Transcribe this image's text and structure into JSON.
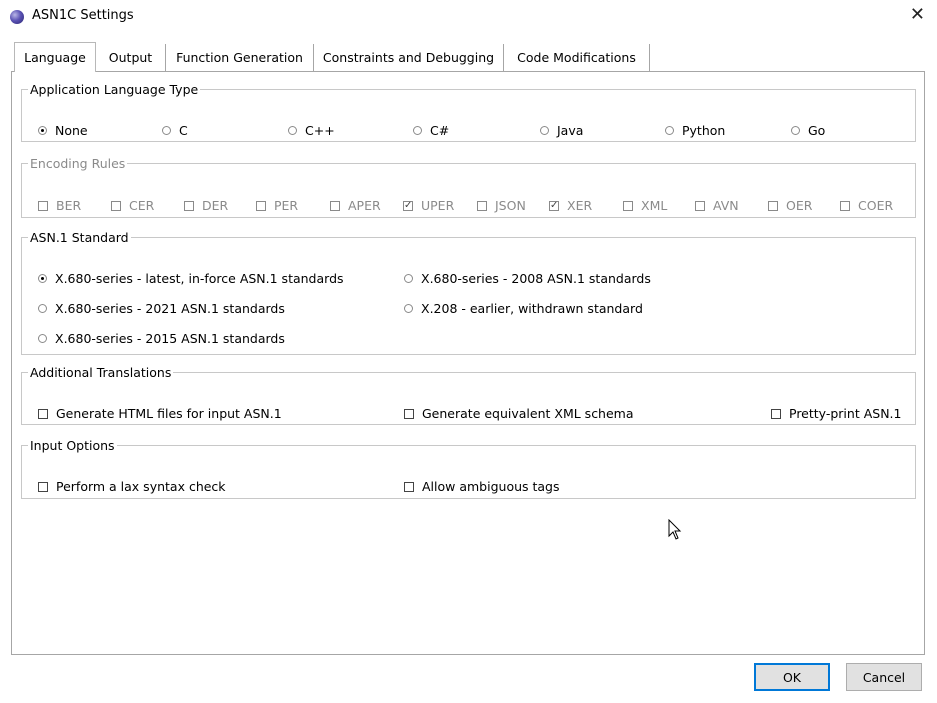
{
  "window": {
    "title": "ASN1C Settings",
    "close_glyph": "✕"
  },
  "tabs": [
    {
      "label": "Language",
      "active": true
    },
    {
      "label": "Output",
      "active": false
    },
    {
      "label": "Function Generation",
      "active": false
    },
    {
      "label": "Constraints and Debugging",
      "active": false
    },
    {
      "label": "Code Modifications",
      "active": false
    }
  ],
  "language_type": {
    "title": "Application Language Type",
    "options": [
      {
        "label": "None",
        "selected": true
      },
      {
        "label": "C",
        "selected": false
      },
      {
        "label": "C++",
        "selected": false
      },
      {
        "label": "C#",
        "selected": false
      },
      {
        "label": "Java",
        "selected": false
      },
      {
        "label": "Python",
        "selected": false
      },
      {
        "label": "Go",
        "selected": false
      }
    ]
  },
  "encoding_rules": {
    "title": "Encoding Rules",
    "options": [
      {
        "label": "BER",
        "checked": false
      },
      {
        "label": "CER",
        "checked": false
      },
      {
        "label": "DER",
        "checked": false
      },
      {
        "label": "PER",
        "checked": false
      },
      {
        "label": "APER",
        "checked": false
      },
      {
        "label": "UPER",
        "checked": true
      },
      {
        "label": "JSON",
        "checked": false
      },
      {
        "label": "XER",
        "checked": true
      },
      {
        "label": "XML",
        "checked": false
      },
      {
        "label": "AVN",
        "checked": false
      },
      {
        "label": "OER",
        "checked": false
      },
      {
        "label": "COER",
        "checked": false
      }
    ]
  },
  "asn1_standard": {
    "title": "ASN.1 Standard",
    "options": [
      {
        "label": "X.680-series - latest, in-force ASN.1 standards",
        "selected": true
      },
      {
        "label": "X.680-series - 2021 ASN.1 standards",
        "selected": false
      },
      {
        "label": "X.680-series - 2015 ASN.1 standards",
        "selected": false
      },
      {
        "label": "X.680-series - 2008 ASN.1 standards",
        "selected": false
      },
      {
        "label": "X.208 - earlier, withdrawn standard",
        "selected": false
      }
    ]
  },
  "additional_translations": {
    "title": "Additional Translations",
    "options": [
      {
        "label": "Generate HTML files for input ASN.1",
        "checked": false
      },
      {
        "label": "Generate equivalent XML schema",
        "checked": false
      },
      {
        "label": "Pretty-print ASN.1",
        "checked": false
      }
    ]
  },
  "input_options": {
    "title": "Input Options",
    "options": [
      {
        "label": "Perform a lax syntax check",
        "checked": false
      },
      {
        "label": "Allow ambiguous tags",
        "checked": false
      }
    ]
  },
  "buttons": {
    "ok": "OK",
    "cancel": "Cancel"
  }
}
